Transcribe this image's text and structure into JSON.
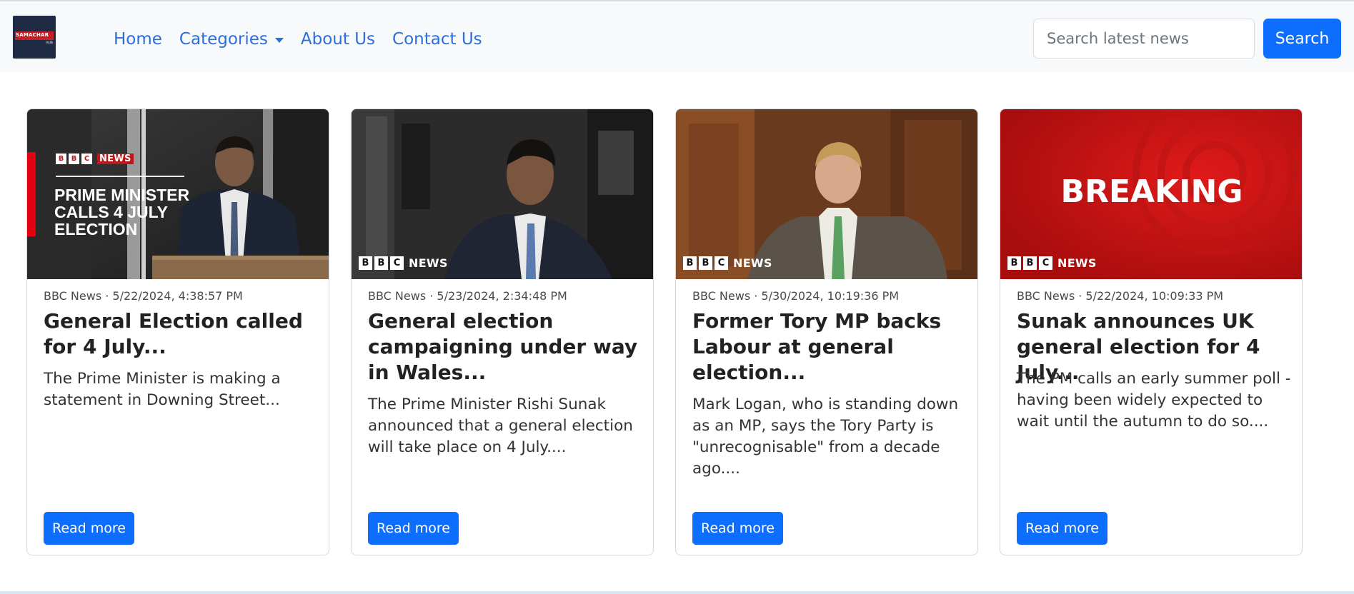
{
  "logo": {
    "line1": "SAMACHAR",
    "line2": "HUB"
  },
  "nav": {
    "home": "Home",
    "categories": "Categories",
    "about": "About Us",
    "contact": "Contact Us"
  },
  "search": {
    "placeholder": "Search latest news",
    "button": "Search"
  },
  "cards": [
    {
      "meta": "BBC News · 5/22/2024, 4:38:57 PM",
      "title": "General Election called for 4 July...",
      "description": "The Prime Minister is making a statement in Downing Street...",
      "button": "Read more",
      "image_text": {
        "brand": "NEWS",
        "headline_1": "PRIME MINISTER",
        "headline_2": "CALLS 4 JULY",
        "headline_3": "ELECTION"
      }
    },
    {
      "meta": "BBC News · 5/23/2024, 2:34:48 PM",
      "title": "General election campaigning under way in Wales...",
      "description": "The Prime Minister Rishi Sunak announced that a general election will take place on 4 July....",
      "button": "Read more",
      "image_text": {
        "brand": "NEWS"
      }
    },
    {
      "meta": "BBC News · 5/30/2024, 10:19:36 PM",
      "title": "Former Tory MP backs Labour at general election...",
      "description": "Mark Logan, who is standing down as an MP, says the Tory Party is \"unrecognisable\" from a decade ago....",
      "button": "Read more",
      "image_text": {
        "brand": "NEWS"
      }
    },
    {
      "meta": "BBC News · 5/22/2024, 10:09:33 PM",
      "title": "Sunak announces UK general election for 4 July...",
      "description": "The PM calls an early summer poll - having been widely expected to wait until the autumn to do so....",
      "button": "Read more",
      "image_text": {
        "brand": "NEWS",
        "headline": "BREAKING"
      }
    }
  ],
  "colors": {
    "primary": "#0d6efd",
    "link": "#2d6fd8",
    "bbc_red": "#bb1919",
    "navbar_bg": "#f8f9fa"
  }
}
